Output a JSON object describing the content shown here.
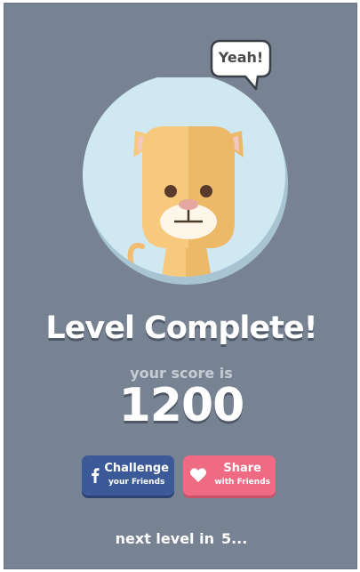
{
  "speech_bubble": {
    "text": "Yeah!"
  },
  "character": {
    "icon": "cat-icon"
  },
  "result": {
    "title": "Level Complete!",
    "score_label": "your score is",
    "score": "1200"
  },
  "buttons": {
    "challenge": {
      "line1": "Challenge",
      "line2": "your Friends",
      "icon": "facebook-icon",
      "color": "#3d5a98"
    },
    "share": {
      "line1": "Share",
      "line2": "with Friends",
      "icon": "heart-icon",
      "color": "#ef6b84"
    }
  },
  "footer": {
    "label": "next level in",
    "countdown": "5..."
  },
  "colors": {
    "background": "#778392",
    "circle": "#cfe8f2",
    "cat_fur": "#f6c97d"
  }
}
